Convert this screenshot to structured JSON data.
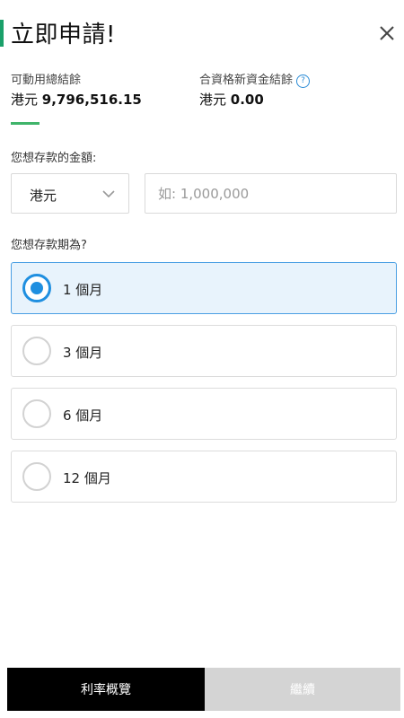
{
  "header": {
    "title": "立即申請!"
  },
  "balances": {
    "available": {
      "label": "可動用總結餘",
      "currency": "港元",
      "amount": "9,796,516.15"
    },
    "eligible": {
      "label": "合資格新資金結餘",
      "currency": "港元",
      "amount": "0.00",
      "help_icon": "?"
    }
  },
  "amount_section": {
    "question": "您想存款的金額:",
    "currency_select": "港元",
    "amount_placeholder": "如: 1,000,000"
  },
  "term_section": {
    "question": "您想存款期為?",
    "options": [
      {
        "label": "1 個月",
        "selected": true
      },
      {
        "label": "3 個月",
        "selected": false
      },
      {
        "label": "6 個月",
        "selected": false
      },
      {
        "label": "12 個月",
        "selected": false
      }
    ]
  },
  "footer": {
    "rates_button": "利率概覽",
    "continue_button": "繼續"
  },
  "colors": {
    "accent_green": "#3fb46a",
    "selected_blue": "#1f8fe0",
    "selected_bg": "#e8f3fc"
  }
}
